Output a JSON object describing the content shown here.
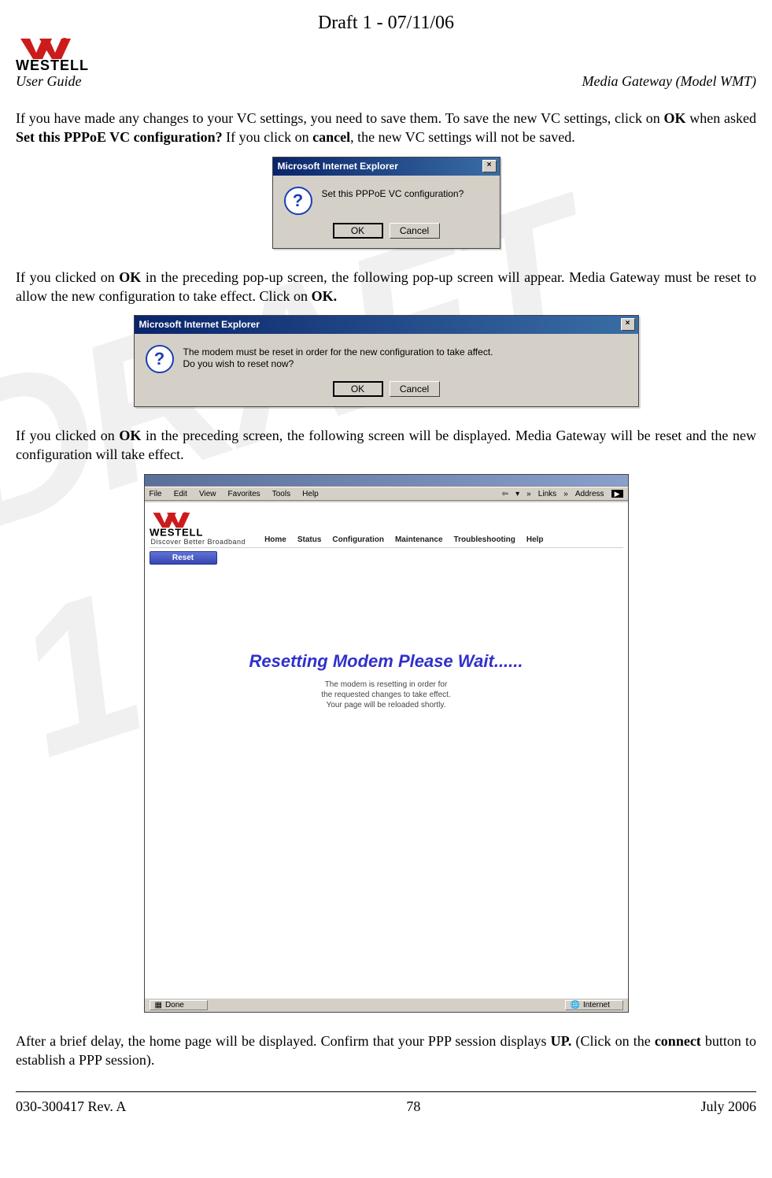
{
  "page_header": {
    "draft_line": "Draft 1 - 07/11/06",
    "left_label": "User Guide",
    "right_label": "Media Gateway (Model WMT)",
    "brand_name": "WESTELL",
    "brand_tagline": "Discover Better Broadband"
  },
  "paragraphs": {
    "p1_pre": "If you have made any changes to your VC settings, you need to save them. To save the new VC settings, click on ",
    "p1_b1": "OK",
    "p1_mid1": " when asked ",
    "p1_b2": "Set this PPPoE VC configuration?",
    "p1_mid2": " If you click on ",
    "p1_b3": "cancel",
    "p1_post": ", the new VC settings will not be saved.",
    "p2_pre": "If you clicked on ",
    "p2_b1": "OK",
    "p2_mid": " in the preceding pop-up screen, the following pop-up screen will appear. Media Gateway must be reset to allow the new configuration to take effect. Click on ",
    "p2_b2": "OK.",
    "p3_pre": "If you clicked on ",
    "p3_b1": "OK",
    "p3_post": " in the preceding screen, the following screen will be displayed. Media Gateway will be reset and the new configuration will take effect.",
    "p4_pre": "After a brief delay, the home page will be displayed. Confirm that your PPP session displays ",
    "p4_b1": "UP.",
    "p4_mid": " (Click on the ",
    "p4_b2": "connect",
    "p4_post": " button to establish a PPP session)."
  },
  "dialog1": {
    "title": "Microsoft Internet Explorer",
    "message": "Set this PPPoE VC configuration?",
    "ok": "OK",
    "cancel": "Cancel"
  },
  "dialog2": {
    "title": "Microsoft Internet Explorer",
    "message": "The modem must be reset in order for the new configuration to take affect.\nDo you wish to reset now?",
    "ok": "OK",
    "cancel": "Cancel"
  },
  "browser": {
    "menus": [
      "File",
      "Edit",
      "View",
      "Favorites",
      "Tools",
      "Help"
    ],
    "right_links": "Links",
    "right_addr": "Address",
    "nav": [
      "Home",
      "Status",
      "Configuration",
      "Maintenance",
      "Troubleshooting",
      "Help"
    ],
    "side_button": "Reset",
    "heading": "Resetting Modem Please Wait......",
    "subtext": "The modem is resetting in order for\nthe requested changes to take effect.\nYour page will be reloaded shortly.",
    "status_left": "Done",
    "status_right": "Internet"
  },
  "footer": {
    "left": "030-300417 Rev. A",
    "center": "78",
    "right": "July 2006"
  }
}
